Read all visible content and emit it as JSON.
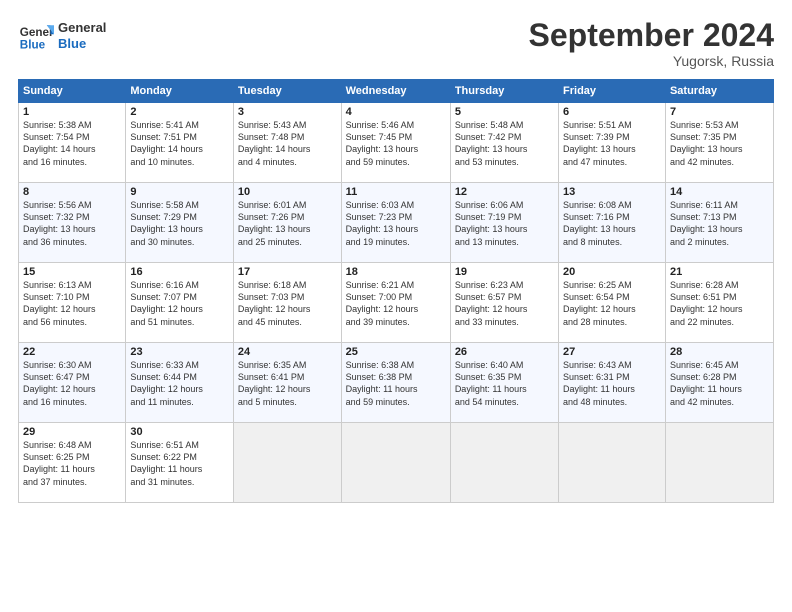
{
  "header": {
    "logo_line1": "General",
    "logo_line2": "Blue",
    "month": "September 2024",
    "location": "Yugorsk, Russia"
  },
  "weekdays": [
    "Sunday",
    "Monday",
    "Tuesday",
    "Wednesday",
    "Thursday",
    "Friday",
    "Saturday"
  ],
  "weeks": [
    [
      {
        "day": "1",
        "info": "Sunrise: 5:38 AM\nSunset: 7:54 PM\nDaylight: 14 hours\nand 16 minutes."
      },
      {
        "day": "2",
        "info": "Sunrise: 5:41 AM\nSunset: 7:51 PM\nDaylight: 14 hours\nand 10 minutes."
      },
      {
        "day": "3",
        "info": "Sunrise: 5:43 AM\nSunset: 7:48 PM\nDaylight: 14 hours\nand 4 minutes."
      },
      {
        "day": "4",
        "info": "Sunrise: 5:46 AM\nSunset: 7:45 PM\nDaylight: 13 hours\nand 59 minutes."
      },
      {
        "day": "5",
        "info": "Sunrise: 5:48 AM\nSunset: 7:42 PM\nDaylight: 13 hours\nand 53 minutes."
      },
      {
        "day": "6",
        "info": "Sunrise: 5:51 AM\nSunset: 7:39 PM\nDaylight: 13 hours\nand 47 minutes."
      },
      {
        "day": "7",
        "info": "Sunrise: 5:53 AM\nSunset: 7:35 PM\nDaylight: 13 hours\nand 42 minutes."
      }
    ],
    [
      {
        "day": "8",
        "info": "Sunrise: 5:56 AM\nSunset: 7:32 PM\nDaylight: 13 hours\nand 36 minutes."
      },
      {
        "day": "9",
        "info": "Sunrise: 5:58 AM\nSunset: 7:29 PM\nDaylight: 13 hours\nand 30 minutes."
      },
      {
        "day": "10",
        "info": "Sunrise: 6:01 AM\nSunset: 7:26 PM\nDaylight: 13 hours\nand 25 minutes."
      },
      {
        "day": "11",
        "info": "Sunrise: 6:03 AM\nSunset: 7:23 PM\nDaylight: 13 hours\nand 19 minutes."
      },
      {
        "day": "12",
        "info": "Sunrise: 6:06 AM\nSunset: 7:19 PM\nDaylight: 13 hours\nand 13 minutes."
      },
      {
        "day": "13",
        "info": "Sunrise: 6:08 AM\nSunset: 7:16 PM\nDaylight: 13 hours\nand 8 minutes."
      },
      {
        "day": "14",
        "info": "Sunrise: 6:11 AM\nSunset: 7:13 PM\nDaylight: 13 hours\nand 2 minutes."
      }
    ],
    [
      {
        "day": "15",
        "info": "Sunrise: 6:13 AM\nSunset: 7:10 PM\nDaylight: 12 hours\nand 56 minutes."
      },
      {
        "day": "16",
        "info": "Sunrise: 6:16 AM\nSunset: 7:07 PM\nDaylight: 12 hours\nand 51 minutes."
      },
      {
        "day": "17",
        "info": "Sunrise: 6:18 AM\nSunset: 7:03 PM\nDaylight: 12 hours\nand 45 minutes."
      },
      {
        "day": "18",
        "info": "Sunrise: 6:21 AM\nSunset: 7:00 PM\nDaylight: 12 hours\nand 39 minutes."
      },
      {
        "day": "19",
        "info": "Sunrise: 6:23 AM\nSunset: 6:57 PM\nDaylight: 12 hours\nand 33 minutes."
      },
      {
        "day": "20",
        "info": "Sunrise: 6:25 AM\nSunset: 6:54 PM\nDaylight: 12 hours\nand 28 minutes."
      },
      {
        "day": "21",
        "info": "Sunrise: 6:28 AM\nSunset: 6:51 PM\nDaylight: 12 hours\nand 22 minutes."
      }
    ],
    [
      {
        "day": "22",
        "info": "Sunrise: 6:30 AM\nSunset: 6:47 PM\nDaylight: 12 hours\nand 16 minutes."
      },
      {
        "day": "23",
        "info": "Sunrise: 6:33 AM\nSunset: 6:44 PM\nDaylight: 12 hours\nand 11 minutes."
      },
      {
        "day": "24",
        "info": "Sunrise: 6:35 AM\nSunset: 6:41 PM\nDaylight: 12 hours\nand 5 minutes."
      },
      {
        "day": "25",
        "info": "Sunrise: 6:38 AM\nSunset: 6:38 PM\nDaylight: 11 hours\nand 59 minutes."
      },
      {
        "day": "26",
        "info": "Sunrise: 6:40 AM\nSunset: 6:35 PM\nDaylight: 11 hours\nand 54 minutes."
      },
      {
        "day": "27",
        "info": "Sunrise: 6:43 AM\nSunset: 6:31 PM\nDaylight: 11 hours\nand 48 minutes."
      },
      {
        "day": "28",
        "info": "Sunrise: 6:45 AM\nSunset: 6:28 PM\nDaylight: 11 hours\nand 42 minutes."
      }
    ],
    [
      {
        "day": "29",
        "info": "Sunrise: 6:48 AM\nSunset: 6:25 PM\nDaylight: 11 hours\nand 37 minutes."
      },
      {
        "day": "30",
        "info": "Sunrise: 6:51 AM\nSunset: 6:22 PM\nDaylight: 11 hours\nand 31 minutes."
      },
      {
        "day": "",
        "info": ""
      },
      {
        "day": "",
        "info": ""
      },
      {
        "day": "",
        "info": ""
      },
      {
        "day": "",
        "info": ""
      },
      {
        "day": "",
        "info": ""
      }
    ]
  ]
}
